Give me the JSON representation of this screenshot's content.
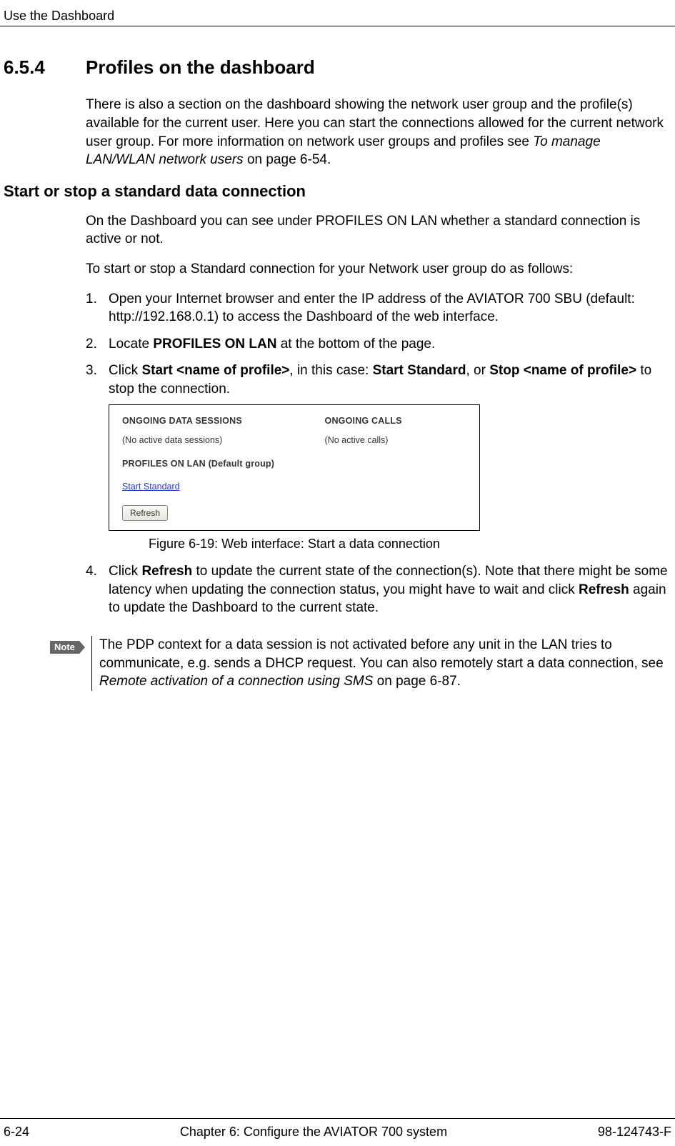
{
  "header": {
    "left": "Use the Dashboard"
  },
  "section": {
    "number": "6.5.4",
    "title": "Profiles on the dashboard",
    "intro_a": "There is also a section on the dashboard showing the network user group and the profile(s) available for the current user. Here you can start the connections allowed for the current network user group. For more information on network user groups and profiles see ",
    "intro_ref": "To manage LAN/WLAN network users",
    "intro_b": " on page 6-54."
  },
  "subsection": {
    "title": "Start or stop a standard data connection",
    "p1": "On the Dashboard you can see under PROFILES ON LAN whether a standard connection is active or not.",
    "p2": "To start or stop a Standard connection for your Network user group do as follows:"
  },
  "steps": {
    "s1": "Open your Internet browser and enter the IP address of the AVIATOR 700 SBU (default: http://192.168.0.1) to access the Dashboard of the web interface.",
    "s2a": "Locate ",
    "s2b": "PROFILES ON LAN",
    "s2c": " at the bottom of the page.",
    "s3a": "Click ",
    "s3b": "Start <name of profile>",
    "s3c": ", in this case: ",
    "s3d": "Start Standard",
    "s3e": ", or ",
    "s3f": "Stop <name of profile>",
    "s3g": " to stop the connection.",
    "s4a": "Click ",
    "s4b": "Refresh",
    "s4c": " to update the current state of the connection(s). Note that there might be some latency when updating the connection status, you might have to wait and click ",
    "s4d": "Refresh",
    "s4e": " again to update the Dashboard to the current state."
  },
  "figure": {
    "h1": "ONGOING DATA SESSIONS",
    "t1": "(No active data sessions)",
    "h2": "ONGOING CALLS",
    "t2": "(No active calls)",
    "h3": "PROFILES ON LAN (Default group)",
    "link": "Start Standard",
    "button": "Refresh",
    "caption": "Figure 6-19: Web interface: Start a data connection"
  },
  "note": {
    "label": "Note",
    "a": "The PDP context for a data session is not activated before any unit in the LAN tries to communicate, e.g. sends a DHCP request. You can also remotely start a data connection, see ",
    "ref": "Remote activation of a connection using SMS",
    "b": " on page 6-87."
  },
  "footer": {
    "left": "6-24",
    "center": "Chapter 6:  Configure the AVIATOR 700 system",
    "right": "98-124743-F"
  }
}
